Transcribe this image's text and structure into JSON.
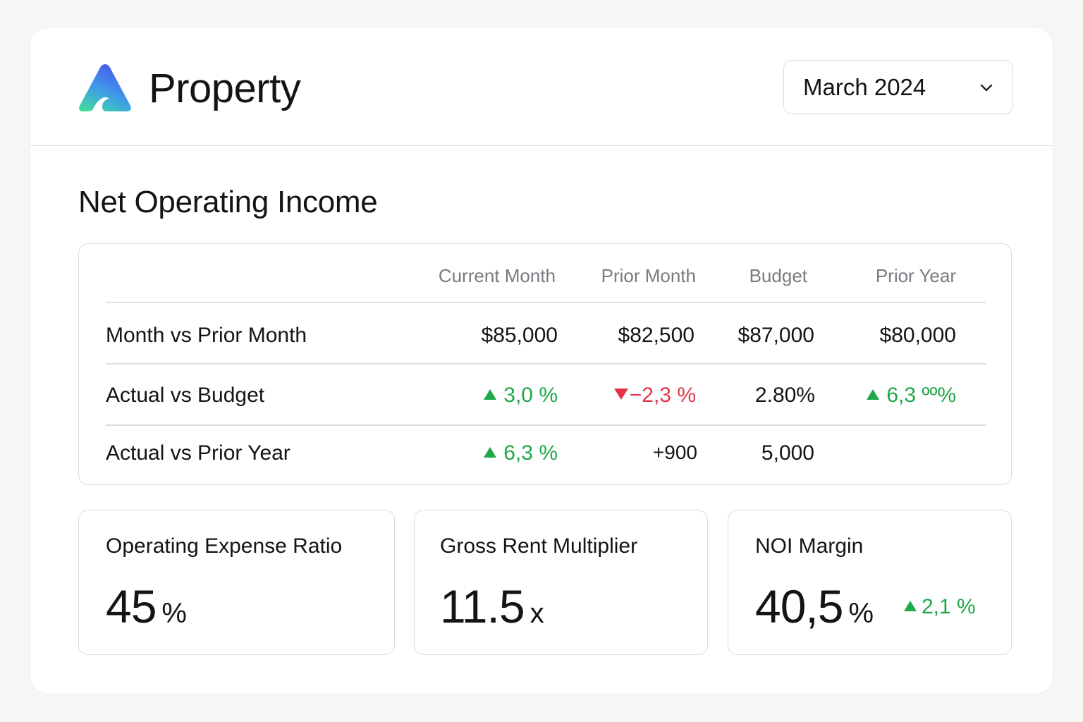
{
  "header": {
    "logo_icon": "app-logo-triangle",
    "title": "Property",
    "period_select": {
      "value": "March 2024",
      "icon": "chevron-down-icon"
    }
  },
  "noi": {
    "title": "Net Operating Income",
    "columns": [
      "Current Month",
      "Prior Month",
      "Budget",
      "Prior Year"
    ],
    "rows": [
      {
        "label": "Month vs Prior Month",
        "values": [
          "$85,000",
          "$82,500",
          "$87,000",
          "$80,000"
        ]
      },
      {
        "label": "Actual vs Budget",
        "values": [
          "3,0 %",
          "−2,3 %",
          "2.80%",
          "6,3 ºº%"
        ]
      },
      {
        "label": "Actual vs Prior Year",
        "values": [
          "6,3 %",
          "+900",
          "5,000",
          ""
        ]
      }
    ]
  },
  "kpis": [
    {
      "label": "Operating Expense Ratio",
      "value": "45",
      "unit": "%"
    },
    {
      "label": "Gross Rent Multiplier",
      "value": "11.5",
      "unit": "x"
    },
    {
      "label": "NOI Margin",
      "value": "40,5",
      "unit": "%",
      "change": "2,1 %"
    }
  ],
  "colors": {
    "positive": "#1fa84a",
    "negative": "#e53248",
    "logo_top": "#4b5cf0",
    "logo_bottom": "#3fd6a0"
  }
}
